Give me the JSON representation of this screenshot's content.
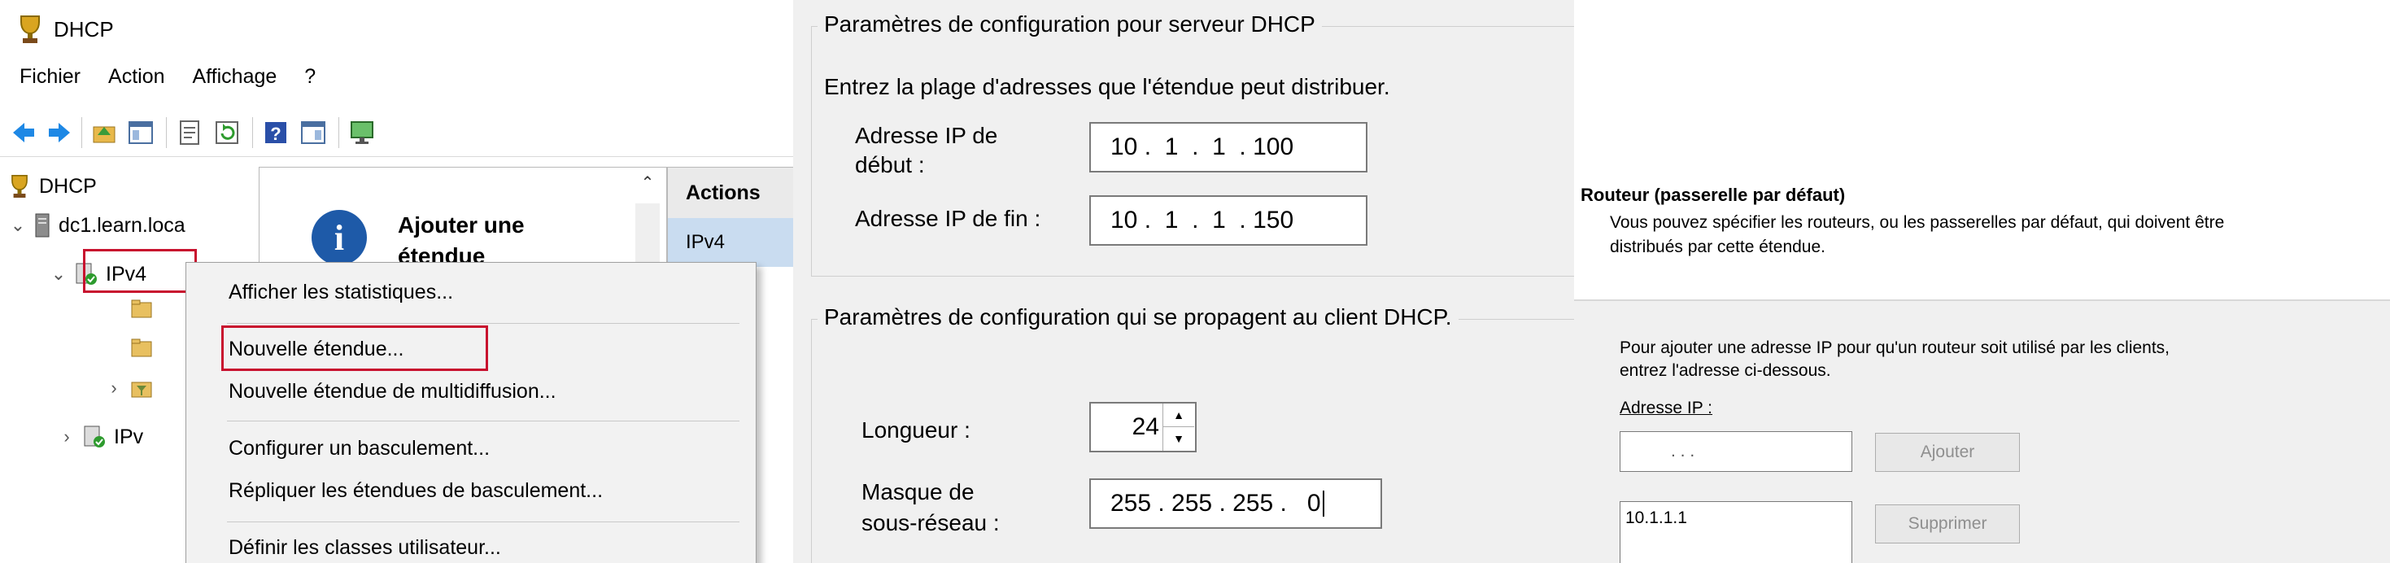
{
  "console": {
    "title": "DHCP",
    "menu": [
      "Fichier",
      "Action",
      "Affichage",
      "?"
    ],
    "tree": {
      "root": "DHCP",
      "server": "dc1.learn.loca",
      "ipv4": "IPv4",
      "ipv6": "IPv"
    },
    "center": {
      "heading": "Ajouter une étendue"
    },
    "actions": {
      "header": "Actions",
      "item": "IPv4"
    },
    "context_menu": [
      "Afficher les statistiques...",
      "Nouvelle étendue...",
      "Nouvelle étendue de multidiffusion...",
      "Configurer un basculement...",
      "Répliquer les étendues de basculement...",
      "Définir les classes utilisateur..."
    ],
    "accent": "#c8102e"
  },
  "config": {
    "server_group_label": "Paramètres de configuration pour serveur DHCP",
    "server_intro": "Entrez la plage d'adresses que l'étendue peut distribuer.",
    "start_label_line1": "Adresse IP de",
    "start_label_line2": "début :",
    "start_ip": "10 .  1  .  1  . 100",
    "end_label": "Adresse IP de fin :",
    "end_ip": "10 .  1  .  1  . 150",
    "client_group_label": "Paramètres de configuration qui se propagent au client DHCP.",
    "length_label": "Longueur :",
    "length_value": "24",
    "mask_label_line1": "Masque de",
    "mask_label_line2": "sous-réseau :",
    "mask_value": "255 . 255 . 255 .   0"
  },
  "router": {
    "title": "Routeur (passerelle par défaut)",
    "desc_line1": "Vous pouvez spécifier les routeurs, ou les passerelles par défaut, qui doivent être",
    "desc_line2": "distribués par cette étendue.",
    "instr_line1": "Pour ajouter une adresse IP pour qu'un routeur soit utilisé par les clients,",
    "instr_line2": "entrez l'adresse ci-dessous.",
    "ip_label": "Adresse IP :",
    "ip_placeholder": ".        .        .",
    "add_button": "Ajouter",
    "list_item": "10.1.1.1",
    "remove_button": "Supprimer"
  }
}
